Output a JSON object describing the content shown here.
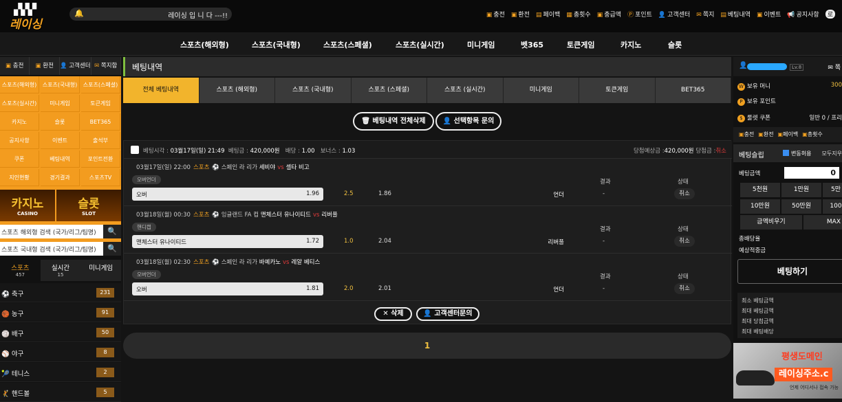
{
  "header": {
    "logo_text": "레이싱",
    "notice": "레이싱 입 니 다 ---!!",
    "nav": [
      {
        "icon": "charge-icon",
        "label": "충전"
      },
      {
        "icon": "exchange-icon",
        "label": "환전"
      },
      {
        "icon": "payback-icon",
        "label": "페이백"
      },
      {
        "icon": "count-icon",
        "label": "총횟수"
      },
      {
        "icon": "wallet-icon",
        "label": "충급액"
      },
      {
        "icon": "point-icon",
        "label": "포인트"
      },
      {
        "icon": "support-icon",
        "label": "고객센터"
      },
      {
        "icon": "note-icon",
        "label": "쪽지"
      },
      {
        "icon": "history-icon",
        "label": "베팅내역"
      },
      {
        "icon": "gift-icon",
        "label": "이벤트"
      },
      {
        "icon": "megaphone-icon",
        "label": "공지사항"
      }
    ],
    "extra": "로"
  },
  "main_nav": [
    "스포츠(해외형)",
    "스포츠(국내형)",
    "스포츠(스페셜)",
    "스포츠(실시간)",
    "미니게임",
    "벳365",
    "토큰게임",
    "카지노",
    "슬롯"
  ],
  "left": {
    "tabs": [
      {
        "icon": "charge-icon",
        "label": "충전"
      },
      {
        "icon": "exchange-icon",
        "label": "환전"
      },
      {
        "icon": "support-icon",
        "label": "고객센터"
      },
      {
        "icon": "note-icon",
        "label": "쪽지함"
      }
    ],
    "grid": [
      "스포츠(해외형)",
      "스포츠(국내형)",
      "스포츠(스페셜)",
      "스포츠(실시간)",
      "미니게임",
      "토큰게임",
      "카지노",
      "슬롯",
      "BET365",
      "공지사항",
      "이벤트",
      "출석부",
      "쿠폰",
      "베팅내역",
      "포인트전환",
      "지인현황",
      "경기결과",
      "스포츠TV"
    ],
    "banners": [
      {
        "title": "카지노",
        "sub": "CASINO"
      },
      {
        "title": "슬롯",
        "sub": "SLOT"
      }
    ],
    "search": [
      "스포츠 해외형 검색 (국가/리그/팀명)",
      "스포츠 국내형 검색 (국가/리그/팀명)"
    ],
    "sport_tabs": [
      {
        "label": "스포츠",
        "count": "457"
      },
      {
        "label": "실시간",
        "count": "15"
      },
      {
        "label": "미니게임",
        "count": ""
      }
    ],
    "sports": [
      {
        "icon": "soccer-icon",
        "glyph": "⚽",
        "name": "축구",
        "count": "231"
      },
      {
        "icon": "basketball-icon",
        "glyph": "🏀",
        "name": "농구",
        "count": "91"
      },
      {
        "icon": "volleyball-icon",
        "glyph": "🏐",
        "name": "배구",
        "count": "50"
      },
      {
        "icon": "baseball-icon",
        "glyph": "⚾",
        "name": "야구",
        "count": "8"
      },
      {
        "icon": "tennis-icon",
        "glyph": "🎾",
        "name": "테니스",
        "count": "2"
      },
      {
        "icon": "handball-icon",
        "glyph": "🤾",
        "name": "핸드볼",
        "count": "5"
      }
    ]
  },
  "center": {
    "title": "베팅내역",
    "tabs": [
      "전체 베팅내역",
      "스포츠 (해외형)",
      "스포츠 (국내형)",
      "스포츠 (스페셜)",
      "스포츠 (실시간)",
      "미니게임",
      "토큰게임",
      "BET365"
    ],
    "delete_all": "베팅내역 전체삭제",
    "inquiry_selected": "선택항목 문의",
    "card_header": {
      "time_label": "베팅시각 :",
      "time": "03월17일(일) 21:49",
      "amount_label": "베팅금 :",
      "amount": "420,000원",
      "odds_label": "배당 :",
      "odds": "1.00",
      "bonus_label": "보너스 :",
      "bonus": "1.03",
      "expected_label": "당첨예상금 :",
      "expected": "420,000원",
      "win_label": "당첨금 :",
      "win": "취소"
    },
    "result_label": "결과",
    "status_label": "상태",
    "bets": [
      {
        "time": "03월17일(일) 22:00",
        "sport": "스포츠",
        "league": "스페인 라 리가",
        "home": "세비야",
        "vs": "vs",
        "away": "셀타 비고",
        "market": "오버언더",
        "pick": "오버",
        "pick_odds": "1.96",
        "handicap": "2.5",
        "alt_odds": "1.86",
        "alt_pick": "언더",
        "result": "-",
        "status": "취소"
      },
      {
        "time": "03월18일(월) 00:30",
        "sport": "스포츠",
        "league": "잉글랜드 FA 컵",
        "home": "맨체스터 유나이티드",
        "vs": "vs",
        "away": "리버풀",
        "market": "핸디캡",
        "pick": "맨체스터 유나이티드",
        "pick_odds": "1.72",
        "handicap": "1.0",
        "alt_odds": "2.04",
        "alt_pick": "리버풀",
        "result": "-",
        "status": "취소"
      },
      {
        "time": "03월18일(월) 02:30",
        "sport": "스포츠",
        "league": "스페인 라 리가",
        "home": "바예카노",
        "vs": "vs",
        "away": "레알 베티스",
        "market": "오버언더",
        "pick": "오버",
        "pick_odds": "1.81",
        "handicap": "2.0",
        "alt_odds": "2.01",
        "alt_pick": "언더",
        "result": "-",
        "status": "취소"
      }
    ],
    "delete": "삭제",
    "support": "고객센터문의",
    "page": "1"
  },
  "right": {
    "level": "Lv.8",
    "note": "쪽",
    "money_label": "보유 머니",
    "money": "300",
    "point_label": "보유 포인트",
    "coupon_label": "룰렛 쿠폰",
    "coupon": "일반 0 / 프리",
    "menu": [
      "충전",
      "환전",
      "페이백",
      "총횟수"
    ],
    "slip_title": "베팅슬립",
    "slip_change": "변동허용",
    "slip_all": "모두지우",
    "amount_label": "베팅금액",
    "amount": "0",
    "chips": [
      "5천원",
      "1만원",
      "5만",
      "10만원",
      "50만원",
      "100"
    ],
    "clear": "금액비우기",
    "max": "MAX",
    "total_odds": "총배당율",
    "expected": "예상적중금",
    "bet_button": "베팅하기",
    "limits": [
      "최소 베팅금액",
      "최대 베팅금액",
      "최대 당첨금액",
      "최대 베팅배당"
    ],
    "ad_line1": "평생도메인",
    "ad_line2": "레이싱주소.c",
    "ad_line3": "언제 어디서나 접속 가능"
  }
}
